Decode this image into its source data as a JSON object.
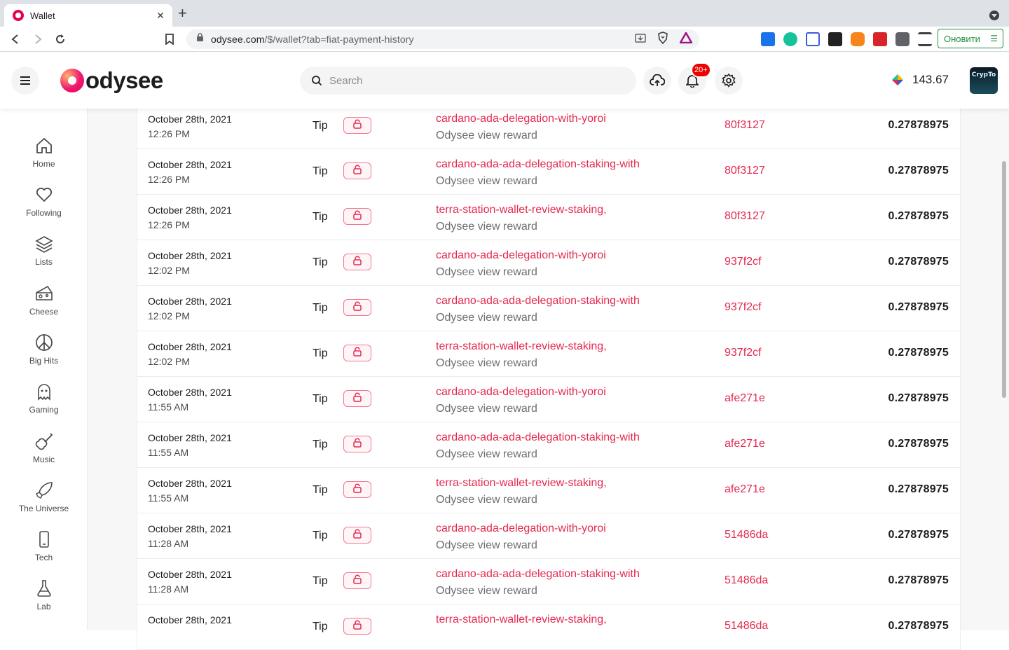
{
  "browser": {
    "tab_title": "Wallet",
    "url_main": "odysee.com",
    "url_rest": "/$/wallet?tab=fiat-payment-history",
    "update_label": "Оновити"
  },
  "header": {
    "logo_text": "odysee",
    "search_placeholder": "Search",
    "notification_badge": "20+",
    "balance": "143.67",
    "avatar_text": "CrypTo"
  },
  "sidebar": {
    "items": [
      {
        "label": "Home",
        "icon": "home-icon"
      },
      {
        "label": "Following",
        "icon": "heart-icon"
      },
      {
        "label": "Lists",
        "icon": "layers-icon"
      },
      {
        "label": "Cheese",
        "icon": "cheese-icon"
      },
      {
        "label": "Big Hits",
        "icon": "peace-icon"
      },
      {
        "label": "Gaming",
        "icon": "ghost-icon"
      },
      {
        "label": "Music",
        "icon": "guitar-icon"
      },
      {
        "label": "The Universe",
        "icon": "rocket-icon"
      },
      {
        "label": "Tech",
        "icon": "phone-icon"
      },
      {
        "label": "Lab",
        "icon": "flask-icon"
      }
    ]
  },
  "transactions": [
    {
      "date": "October 28th, 2021",
      "time": "12:26 PM",
      "type": "Tip",
      "title": "cardano-ada-delegation-with-yoroi",
      "subtitle": "Odysee view reward",
      "claim": "80f3127",
      "amount": "0.27878975"
    },
    {
      "date": "October 28th, 2021",
      "time": "12:26 PM",
      "type": "Tip",
      "title": "cardano-ada-ada-delegation-staking-with",
      "subtitle": "Odysee view reward",
      "claim": "80f3127",
      "amount": "0.27878975"
    },
    {
      "date": "October 28th, 2021",
      "time": "12:26 PM",
      "type": "Tip",
      "title": "terra-station-wallet-review-staking,",
      "subtitle": "Odysee view reward",
      "claim": "80f3127",
      "amount": "0.27878975"
    },
    {
      "date": "October 28th, 2021",
      "time": "12:02 PM",
      "type": "Tip",
      "title": "cardano-ada-delegation-with-yoroi",
      "subtitle": "Odysee view reward",
      "claim": "937f2cf",
      "amount": "0.27878975"
    },
    {
      "date": "October 28th, 2021",
      "time": "12:02 PM",
      "type": "Tip",
      "title": "cardano-ada-ada-delegation-staking-with",
      "subtitle": "Odysee view reward",
      "claim": "937f2cf",
      "amount": "0.27878975"
    },
    {
      "date": "October 28th, 2021",
      "time": "12:02 PM",
      "type": "Tip",
      "title": "terra-station-wallet-review-staking,",
      "subtitle": "Odysee view reward",
      "claim": "937f2cf",
      "amount": "0.27878975"
    },
    {
      "date": "October 28th, 2021",
      "time": "11:55 AM",
      "type": "Tip",
      "title": "cardano-ada-delegation-with-yoroi",
      "subtitle": "Odysee view reward",
      "claim": "afe271e",
      "amount": "0.27878975"
    },
    {
      "date": "October 28th, 2021",
      "time": "11:55 AM",
      "type": "Tip",
      "title": "cardano-ada-ada-delegation-staking-with",
      "subtitle": "Odysee view reward",
      "claim": "afe271e",
      "amount": "0.27878975"
    },
    {
      "date": "October 28th, 2021",
      "time": "11:55 AM",
      "type": "Tip",
      "title": "terra-station-wallet-review-staking,",
      "subtitle": "Odysee view reward",
      "claim": "afe271e",
      "amount": "0.27878975"
    },
    {
      "date": "October 28th, 2021",
      "time": "11:28 AM",
      "type": "Tip",
      "title": "cardano-ada-delegation-with-yoroi",
      "subtitle": "Odysee view reward",
      "claim": "51486da",
      "amount": "0.27878975"
    },
    {
      "date": "October 28th, 2021",
      "time": "11:28 AM",
      "type": "Tip",
      "title": "cardano-ada-ada-delegation-staking-with",
      "subtitle": "Odysee view reward",
      "claim": "51486da",
      "amount": "0.27878975"
    },
    {
      "date": "October 28th, 2021",
      "time": "",
      "type": "Tip",
      "title": "terra-station-wallet-review-staking,",
      "subtitle": "",
      "claim": "51486da",
      "amount": "0.27878975"
    }
  ],
  "colors": {
    "accent": "#e5294f",
    "brand": "#e50054"
  }
}
